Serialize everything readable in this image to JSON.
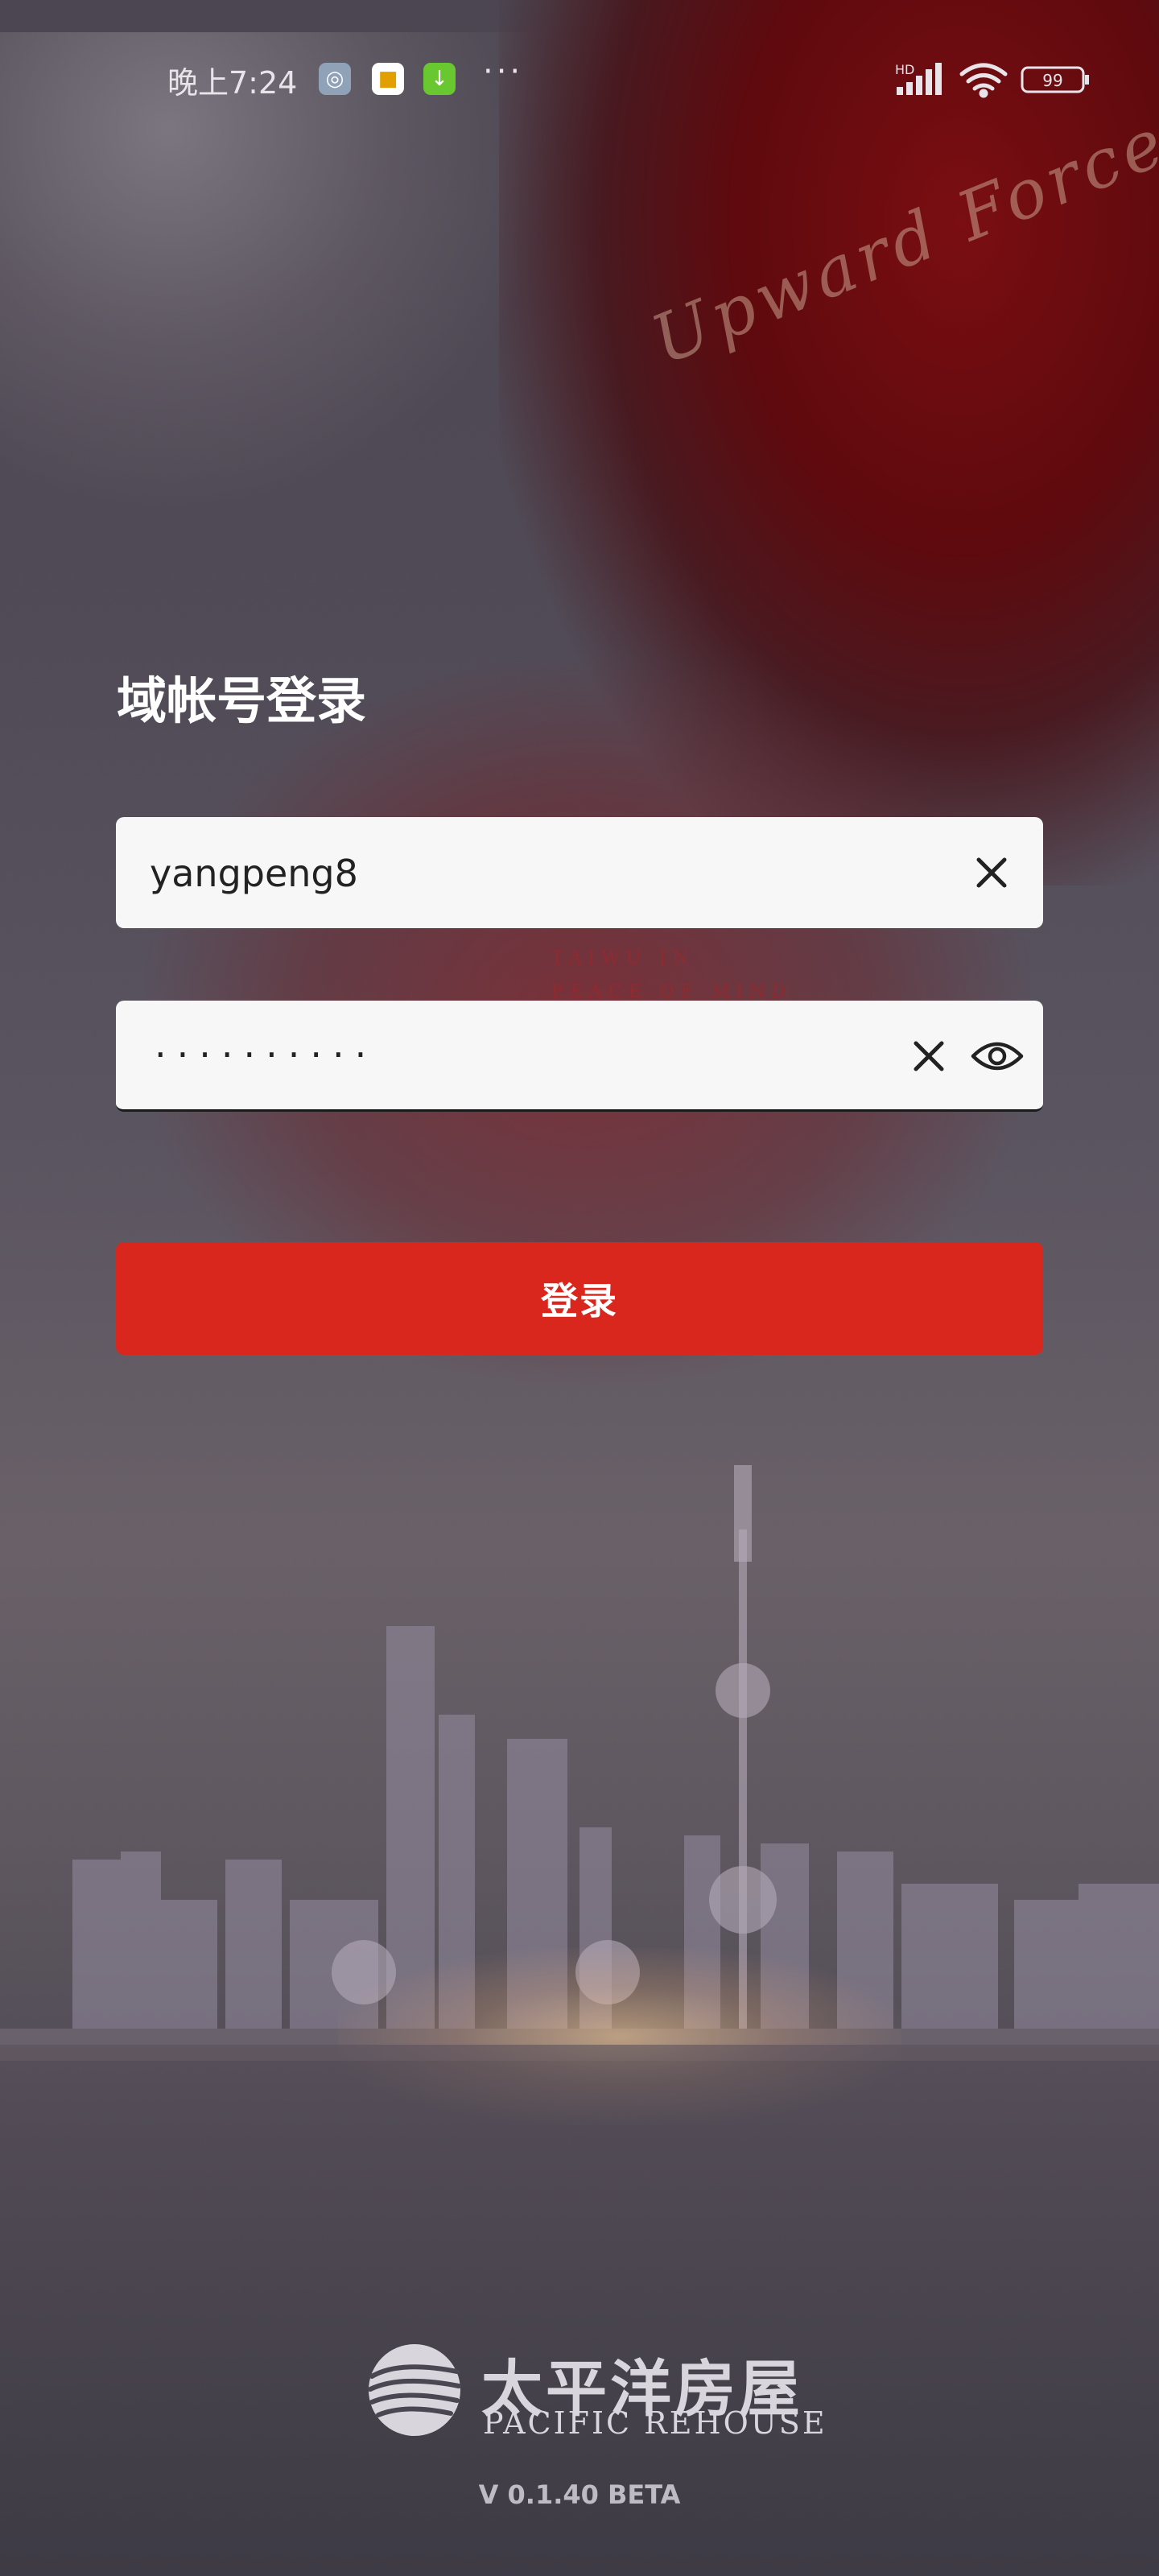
{
  "status_bar": {
    "time": "晚上7:24",
    "dots": "···",
    "battery": "99",
    "network": "HD"
  },
  "background": {
    "script_text": "Upward Force",
    "tagline_1": "TAIWU IN",
    "tagline_2": "PEACE OF MIND"
  },
  "login": {
    "title": "域帐号登录",
    "username_value": "yangpeng8",
    "password_masked": "··········",
    "submit_label": "登录"
  },
  "brand": {
    "name_cn": "太平洋房屋",
    "name_en": "PACIFIC REHOUSE",
    "version": "V 0.1.40 BETA"
  },
  "colors": {
    "accent": "#d9271e",
    "field_bg": "#f7f7f7"
  }
}
